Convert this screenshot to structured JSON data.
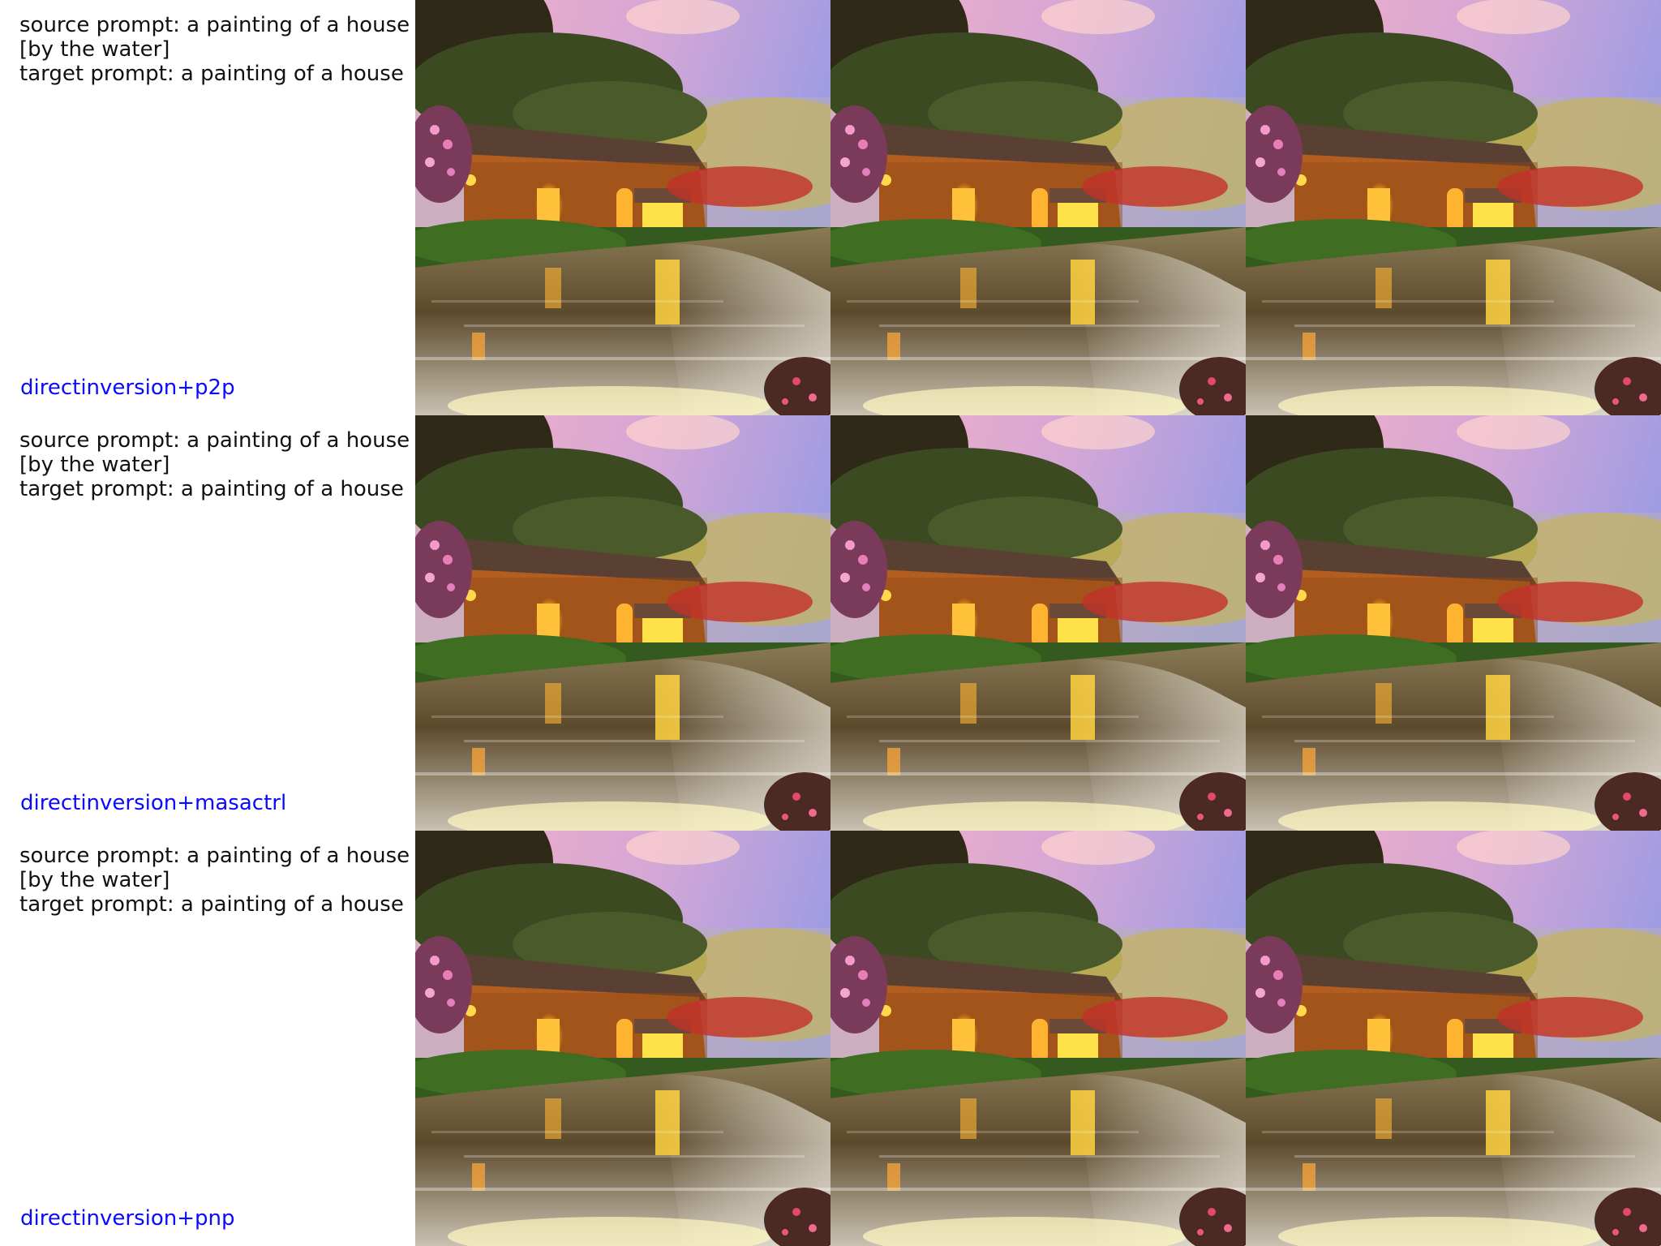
{
  "rows": [
    {
      "source_line1": "source prompt: a painting of a house",
      "source_line2": "[by the water]",
      "target_line": "target prompt: a painting of a house",
      "method": "directinversion+p2p"
    },
    {
      "source_line1": "source prompt: a painting of a house",
      "source_line2": "[by the water]",
      "target_line": "target prompt: a painting of a house",
      "method": "directinversion+masactrl"
    },
    {
      "source_line1": "source prompt: a painting of a house",
      "source_line2": "[by the water]",
      "target_line": "target prompt: a painting of a house",
      "method": "directinversion+pnp"
    }
  ],
  "colors": {
    "method_label": "#0a0aff",
    "prompt_text": "#111111",
    "sky_pink": "#f2a3b8",
    "sky_lavender": "#a7a0e0",
    "foliage_dark": "#2e3a1c",
    "house_wall": "#a8561c",
    "window_glow": "#ffd23a",
    "water": "#6b5a3a"
  }
}
